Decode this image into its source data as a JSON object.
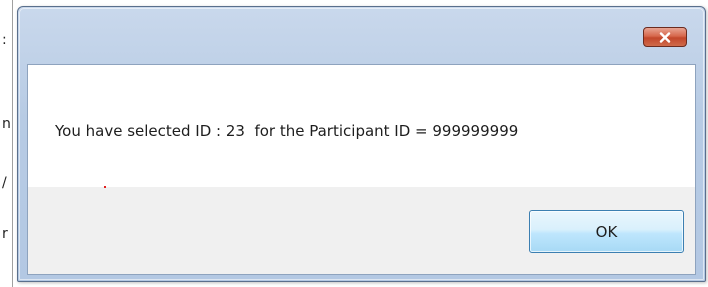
{
  "background": {
    "partial_chars": [
      ":",
      "n",
      "/",
      "r"
    ]
  },
  "dialog": {
    "close_icon": "close-x-icon",
    "message": "You have selected ID : 23  for the Participant ID = 999999999",
    "ok_label": "OK"
  },
  "colors": {
    "close_button": "#c2462b",
    "ok_button_border": "#3c7fb1",
    "titlebar": "#b7cbe4"
  }
}
